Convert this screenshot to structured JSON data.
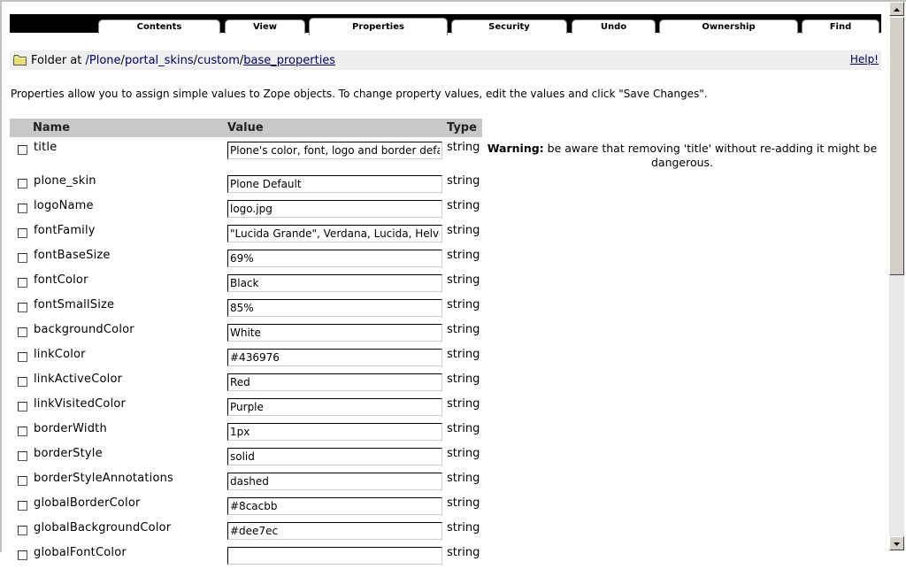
{
  "tabs": [
    {
      "label": "Contents"
    },
    {
      "label": "View"
    },
    {
      "label": "Properties"
    },
    {
      "label": "Security"
    },
    {
      "label": "Undo"
    },
    {
      "label": "Ownership"
    },
    {
      "label": "Find"
    }
  ],
  "location": {
    "prefix": "Folder at",
    "path": [
      "/Plone",
      "/",
      "portal_skins",
      "/",
      "custom",
      "/",
      "base_properties"
    ],
    "help": "Help!"
  },
  "description": "Properties allow you to assign simple values to Zope objects. To change property values, edit the values and click \"Save Changes\".",
  "table": {
    "headers": {
      "name": "Name",
      "value": "Value",
      "type": "Type"
    },
    "rows": [
      {
        "name": "title",
        "value": "Plone's color, font, logo and border defaults",
        "type": "string"
      },
      {
        "name": "plone_skin",
        "value": "Plone Default",
        "type": "string"
      },
      {
        "name": "logoName",
        "value": "logo.jpg",
        "type": "string"
      },
      {
        "name": "fontFamily",
        "value": "\"Lucida Grande\", Verdana, Lucida, Helvetica",
        "type": "string"
      },
      {
        "name": "fontBaseSize",
        "value": "69%",
        "type": "string"
      },
      {
        "name": "fontColor",
        "value": "Black",
        "type": "string"
      },
      {
        "name": "fontSmallSize",
        "value": "85%",
        "type": "string"
      },
      {
        "name": "backgroundColor",
        "value": "White",
        "type": "string"
      },
      {
        "name": "linkColor",
        "value": "#436976",
        "type": "string"
      },
      {
        "name": "linkActiveColor",
        "value": "Red",
        "type": "string"
      },
      {
        "name": "linkVisitedColor",
        "value": "Purple",
        "type": "string"
      },
      {
        "name": "borderWidth",
        "value": "1px",
        "type": "string"
      },
      {
        "name": "borderStyle",
        "value": "solid",
        "type": "string"
      },
      {
        "name": "borderStyleAnnotations",
        "value": "dashed",
        "type": "string"
      },
      {
        "name": "globalBorderColor",
        "value": "#8cacbb",
        "type": "string"
      },
      {
        "name": "globalBackgroundColor",
        "value": "#dee7ec",
        "type": "string"
      },
      {
        "name": "globalFontColor",
        "value": "",
        "type": "string"
      }
    ]
  },
  "warning": {
    "label": "Warning:",
    "text": " be aware that removing 'title' without re-adding it might be dangerous."
  },
  "icons": {
    "folder": "folder-icon",
    "scroll_up": "arrow-up-icon",
    "scroll_down": "arrow-down-icon"
  },
  "colors": {
    "tabbar": "#000000",
    "header_bg": "#c8c8c8",
    "locbar_bg": "#efefef",
    "link": "#000066"
  }
}
